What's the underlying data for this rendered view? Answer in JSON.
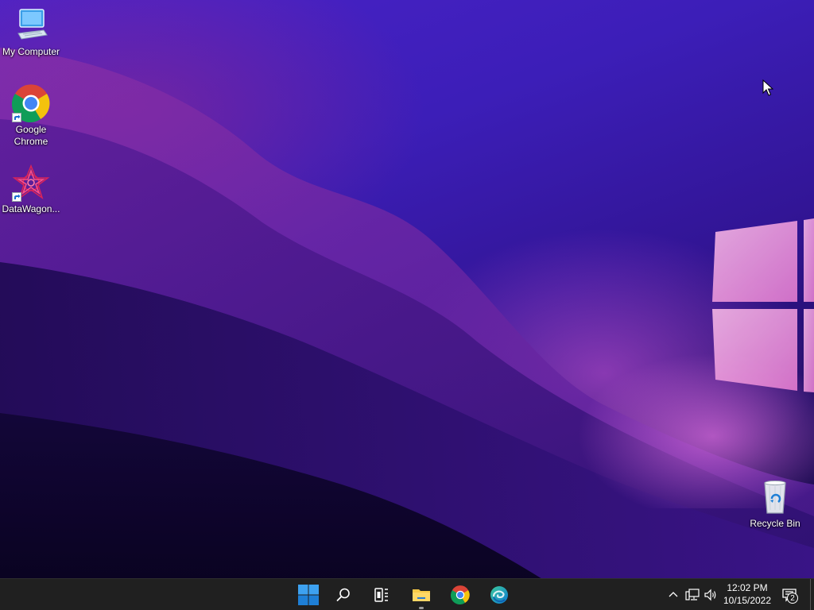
{
  "desktop": {
    "icons": [
      {
        "label": "My Computer",
        "icon": "computer-icon"
      },
      {
        "label": "Google Chrome",
        "icon": "chrome-icon"
      },
      {
        "label": "DataWagon...",
        "icon": "datawagon-icon"
      },
      {
        "label": "Recycle Bin",
        "icon": "recycle-bin-icon"
      }
    ],
    "wallpaper_accent": "#d65adc"
  },
  "taskbar": {
    "apps": [
      {
        "name": "Start",
        "icon": "windows-start-icon"
      },
      {
        "name": "Search",
        "icon": "search-icon"
      },
      {
        "name": "Task View",
        "icon": "task-view-icon"
      },
      {
        "name": "File Explorer",
        "icon": "folder-icon"
      },
      {
        "name": "Google Chrome",
        "icon": "chrome-icon"
      },
      {
        "name": "Microsoft Edge",
        "icon": "edge-icon"
      }
    ],
    "tray": {
      "time": "12:02 PM",
      "date": "10/15/2022",
      "notification_count": "2"
    },
    "accent_color": "#0078d4"
  }
}
